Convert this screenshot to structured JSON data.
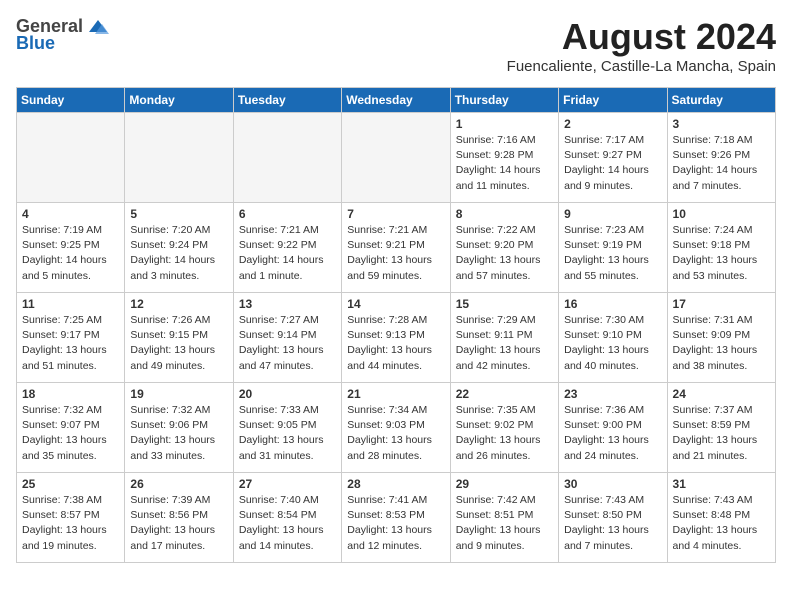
{
  "header": {
    "logo_general": "General",
    "logo_blue": "Blue",
    "month_year": "August 2024",
    "location": "Fuencaliente, Castille-La Mancha, Spain"
  },
  "days_of_week": [
    "Sunday",
    "Monday",
    "Tuesday",
    "Wednesday",
    "Thursday",
    "Friday",
    "Saturday"
  ],
  "weeks": [
    [
      {
        "day": "",
        "empty": true
      },
      {
        "day": "",
        "empty": true
      },
      {
        "day": "",
        "empty": true
      },
      {
        "day": "",
        "empty": true
      },
      {
        "day": "1",
        "sunrise": "Sunrise: 7:16 AM",
        "sunset": "Sunset: 9:28 PM",
        "daylight": "Daylight: 14 hours and 11 minutes."
      },
      {
        "day": "2",
        "sunrise": "Sunrise: 7:17 AM",
        "sunset": "Sunset: 9:27 PM",
        "daylight": "Daylight: 14 hours and 9 minutes."
      },
      {
        "day": "3",
        "sunrise": "Sunrise: 7:18 AM",
        "sunset": "Sunset: 9:26 PM",
        "daylight": "Daylight: 14 hours and 7 minutes."
      }
    ],
    [
      {
        "day": "4",
        "sunrise": "Sunrise: 7:19 AM",
        "sunset": "Sunset: 9:25 PM",
        "daylight": "Daylight: 14 hours and 5 minutes."
      },
      {
        "day": "5",
        "sunrise": "Sunrise: 7:20 AM",
        "sunset": "Sunset: 9:24 PM",
        "daylight": "Daylight: 14 hours and 3 minutes."
      },
      {
        "day": "6",
        "sunrise": "Sunrise: 7:21 AM",
        "sunset": "Sunset: 9:22 PM",
        "daylight": "Daylight: 14 hours and 1 minute."
      },
      {
        "day": "7",
        "sunrise": "Sunrise: 7:21 AM",
        "sunset": "Sunset: 9:21 PM",
        "daylight": "Daylight: 13 hours and 59 minutes."
      },
      {
        "day": "8",
        "sunrise": "Sunrise: 7:22 AM",
        "sunset": "Sunset: 9:20 PM",
        "daylight": "Daylight: 13 hours and 57 minutes."
      },
      {
        "day": "9",
        "sunrise": "Sunrise: 7:23 AM",
        "sunset": "Sunset: 9:19 PM",
        "daylight": "Daylight: 13 hours and 55 minutes."
      },
      {
        "day": "10",
        "sunrise": "Sunrise: 7:24 AM",
        "sunset": "Sunset: 9:18 PM",
        "daylight": "Daylight: 13 hours and 53 minutes."
      }
    ],
    [
      {
        "day": "11",
        "sunrise": "Sunrise: 7:25 AM",
        "sunset": "Sunset: 9:17 PM",
        "daylight": "Daylight: 13 hours and 51 minutes."
      },
      {
        "day": "12",
        "sunrise": "Sunrise: 7:26 AM",
        "sunset": "Sunset: 9:15 PM",
        "daylight": "Daylight: 13 hours and 49 minutes."
      },
      {
        "day": "13",
        "sunrise": "Sunrise: 7:27 AM",
        "sunset": "Sunset: 9:14 PM",
        "daylight": "Daylight: 13 hours and 47 minutes."
      },
      {
        "day": "14",
        "sunrise": "Sunrise: 7:28 AM",
        "sunset": "Sunset: 9:13 PM",
        "daylight": "Daylight: 13 hours and 44 minutes."
      },
      {
        "day": "15",
        "sunrise": "Sunrise: 7:29 AM",
        "sunset": "Sunset: 9:11 PM",
        "daylight": "Daylight: 13 hours and 42 minutes."
      },
      {
        "day": "16",
        "sunrise": "Sunrise: 7:30 AM",
        "sunset": "Sunset: 9:10 PM",
        "daylight": "Daylight: 13 hours and 40 minutes."
      },
      {
        "day": "17",
        "sunrise": "Sunrise: 7:31 AM",
        "sunset": "Sunset: 9:09 PM",
        "daylight": "Daylight: 13 hours and 38 minutes."
      }
    ],
    [
      {
        "day": "18",
        "sunrise": "Sunrise: 7:32 AM",
        "sunset": "Sunset: 9:07 PM",
        "daylight": "Daylight: 13 hours and 35 minutes."
      },
      {
        "day": "19",
        "sunrise": "Sunrise: 7:32 AM",
        "sunset": "Sunset: 9:06 PM",
        "daylight": "Daylight: 13 hours and 33 minutes."
      },
      {
        "day": "20",
        "sunrise": "Sunrise: 7:33 AM",
        "sunset": "Sunset: 9:05 PM",
        "daylight": "Daylight: 13 hours and 31 minutes."
      },
      {
        "day": "21",
        "sunrise": "Sunrise: 7:34 AM",
        "sunset": "Sunset: 9:03 PM",
        "daylight": "Daylight: 13 hours and 28 minutes."
      },
      {
        "day": "22",
        "sunrise": "Sunrise: 7:35 AM",
        "sunset": "Sunset: 9:02 PM",
        "daylight": "Daylight: 13 hours and 26 minutes."
      },
      {
        "day": "23",
        "sunrise": "Sunrise: 7:36 AM",
        "sunset": "Sunset: 9:00 PM",
        "daylight": "Daylight: 13 hours and 24 minutes."
      },
      {
        "day": "24",
        "sunrise": "Sunrise: 7:37 AM",
        "sunset": "Sunset: 8:59 PM",
        "daylight": "Daylight: 13 hours and 21 minutes."
      }
    ],
    [
      {
        "day": "25",
        "sunrise": "Sunrise: 7:38 AM",
        "sunset": "Sunset: 8:57 PM",
        "daylight": "Daylight: 13 hours and 19 minutes."
      },
      {
        "day": "26",
        "sunrise": "Sunrise: 7:39 AM",
        "sunset": "Sunset: 8:56 PM",
        "daylight": "Daylight: 13 hours and 17 minutes."
      },
      {
        "day": "27",
        "sunrise": "Sunrise: 7:40 AM",
        "sunset": "Sunset: 8:54 PM",
        "daylight": "Daylight: 13 hours and 14 minutes."
      },
      {
        "day": "28",
        "sunrise": "Sunrise: 7:41 AM",
        "sunset": "Sunset: 8:53 PM",
        "daylight": "Daylight: 13 hours and 12 minutes."
      },
      {
        "day": "29",
        "sunrise": "Sunrise: 7:42 AM",
        "sunset": "Sunset: 8:51 PM",
        "daylight": "Daylight: 13 hours and 9 minutes."
      },
      {
        "day": "30",
        "sunrise": "Sunrise: 7:43 AM",
        "sunset": "Sunset: 8:50 PM",
        "daylight": "Daylight: 13 hours and 7 minutes."
      },
      {
        "day": "31",
        "sunrise": "Sunrise: 7:43 AM",
        "sunset": "Sunset: 8:48 PM",
        "daylight": "Daylight: 13 hours and 4 minutes."
      }
    ]
  ]
}
